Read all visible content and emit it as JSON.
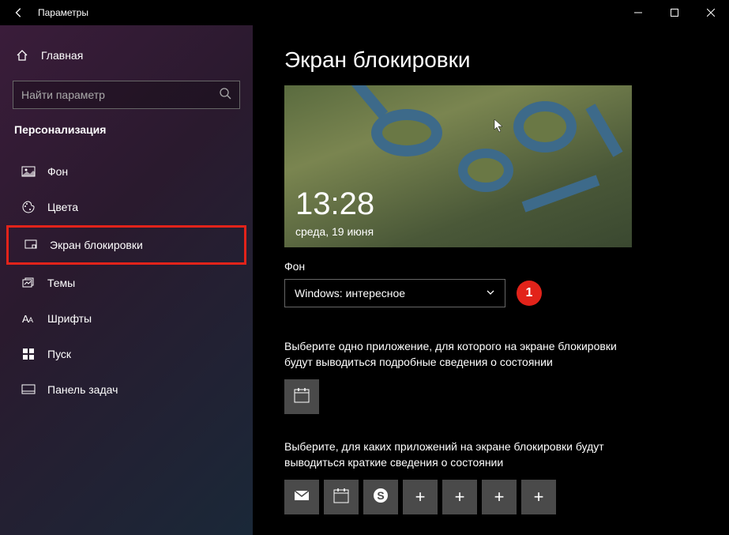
{
  "window": {
    "title": "Параметры"
  },
  "sidebar": {
    "home_label": "Главная",
    "search_placeholder": "Найти параметр",
    "category": "Персонализация",
    "items": [
      {
        "label": "Фон",
        "icon": "picture"
      },
      {
        "label": "Цвета",
        "icon": "palette"
      },
      {
        "label": "Экран блокировки",
        "icon": "lockscreen",
        "selected": true
      },
      {
        "label": "Темы",
        "icon": "themes"
      },
      {
        "label": "Шрифты",
        "icon": "fonts"
      },
      {
        "label": "Пуск",
        "icon": "start"
      },
      {
        "label": "Панель задач",
        "icon": "taskbar"
      }
    ]
  },
  "main": {
    "heading": "Экран блокировки",
    "preview": {
      "time": "13:28",
      "date": "среда, 19 июня"
    },
    "background_label": "Фон",
    "background_value": "Windows: интересное",
    "badge": "1",
    "detailed_text": "Выберите одно приложение, для которого на экране блокировки будут выводиться подробные сведения о состоянии",
    "quick_text": "Выберите, для каких приложений на экране блокировки будут выводиться краткие сведения о состоянии"
  }
}
